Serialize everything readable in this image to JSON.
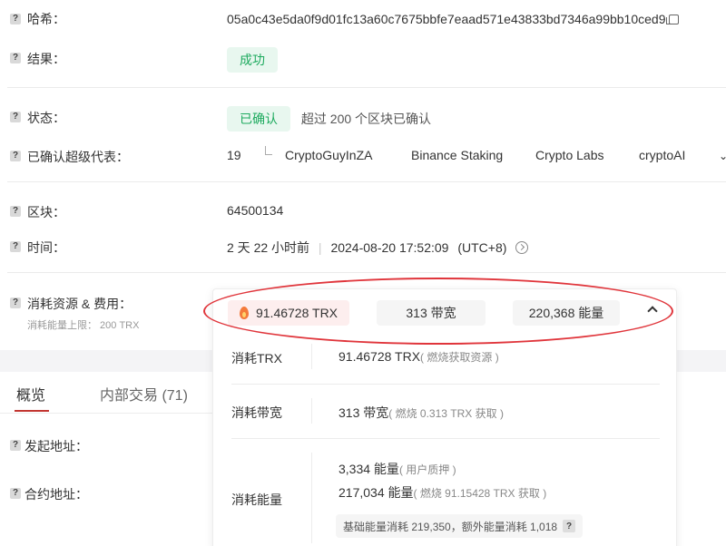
{
  "fields": {
    "hash": {
      "label": "哈希：",
      "value": "05a0c43e5da0f9d01fc13a60c7675bbfe7eaad571e43833bd7346a99bb10ced9"
    },
    "result": {
      "label": "结果：",
      "value": "成功"
    },
    "status": {
      "label": "状态：",
      "badge": "已确认",
      "note": "超过 200 个区块已确认"
    },
    "sr": {
      "label": "已确认超级代表：",
      "count": "19",
      "items": [
        "CryptoGuyInZA",
        "Binance Staking",
        "Crypto Labs",
        "cryptoAI"
      ]
    },
    "block": {
      "label": "区块：",
      "value": "64500134"
    },
    "time": {
      "label": "时间：",
      "relative": "2 天 22 小时前",
      "separator": "|",
      "absolute": "2024-08-20 17:52:09",
      "tz": "(UTC+8)"
    },
    "resources": {
      "label": "消耗资源 & 费用：",
      "sublabel": "消耗能量上限： 200 TRX"
    }
  },
  "resource_card": {
    "summary": {
      "trx": "91.46728  TRX",
      "bandwidth": "313  带宽",
      "energy": "220,368  能量"
    },
    "trx_row": {
      "label": "消耗TRX",
      "value": "91.46728 TRX",
      "note": "( 燃烧获取资源 )"
    },
    "bw_row": {
      "label": "消耗带宽",
      "value": "313 带宽",
      "note": "( 燃烧 0.313 TRX 获取 )"
    },
    "energy_row": {
      "label": "消耗能量",
      "line1_value": "3,334 能量",
      "line1_note": "( 用户质押 )",
      "line2_value": "217,034 能量",
      "line2_note": "( 燃烧 91.15428 TRX 获取 )",
      "base": "基础能量消耗 219,350，额外能量消耗 1,018"
    }
  },
  "tabs": [
    {
      "label": "概览",
      "active": true
    },
    {
      "label": "内部交易 (71)",
      "active": false
    }
  ],
  "overview": {
    "from_label": "发起地址：",
    "contract_label": "合约地址："
  },
  "colors": {
    "accent_red": "#c23631",
    "success_green": "#1daa5e",
    "highlight_ellipse": "#e0353b"
  }
}
